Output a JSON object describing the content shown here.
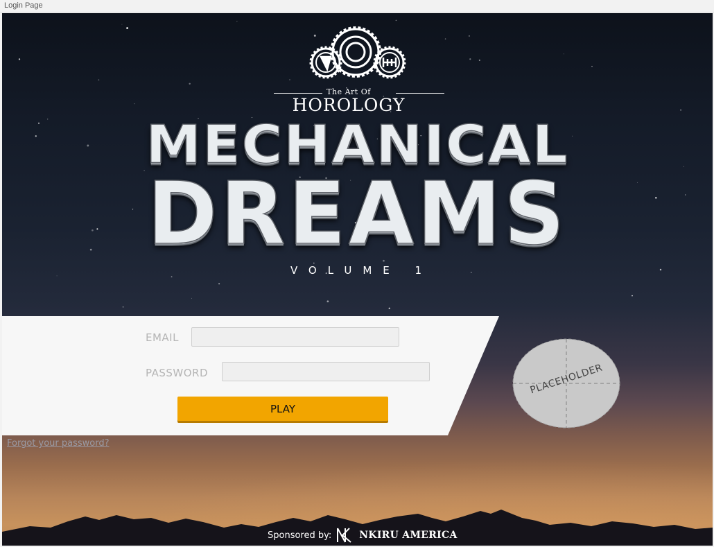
{
  "window": {
    "title": "Login Page"
  },
  "brand": {
    "logo_subtitle": "The Art Of",
    "logo_name": "HOROLOGY",
    "title_line1": "MECHANICAL",
    "title_line2": "DREAMS",
    "volume": "VOLUME 1"
  },
  "login": {
    "email_label": "EMAIL",
    "email_value": "",
    "password_label": "PASSWORD",
    "password_value": "",
    "play_label": "PLAY",
    "forgot_label": "Forgot your password?"
  },
  "placeholder": {
    "label": "PLACEHOLDER"
  },
  "sponsor": {
    "label": "Sponsored by:",
    "name": "NKIRU AMERICA"
  },
  "colors": {
    "accent": "#f2a500",
    "panel": "#f7f7f7",
    "label": "#b5b5b5",
    "sky_top": "#0d121b",
    "sky_bottom": "#c7925d"
  },
  "icons": [
    "gear-logo-icon",
    "nkiru-monogram-icon"
  ]
}
